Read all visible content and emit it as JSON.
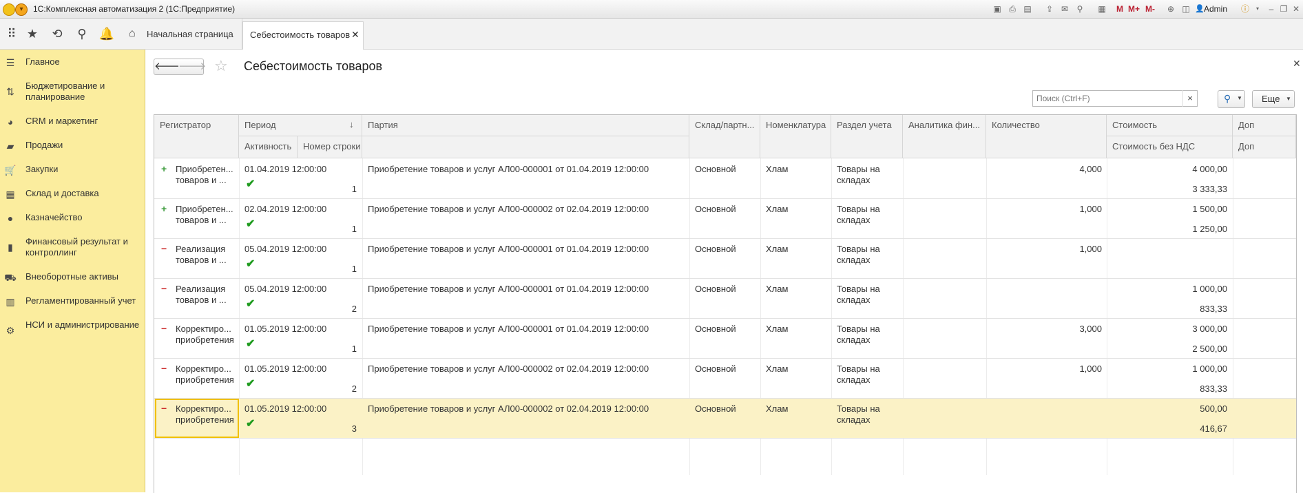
{
  "window": {
    "title": "1С:Комплексная автоматизация 2  (1С:Предприятие)",
    "user": "Admin"
  },
  "tabs": {
    "home": "Начальная страница",
    "active": "Себестоимость товаров"
  },
  "sidebar": {
    "items": [
      {
        "label": "Главное",
        "icon": "menu-icon"
      },
      {
        "label": "Бюджетирование и планирование",
        "icon": "budget-icon"
      },
      {
        "label": "CRM и маркетинг",
        "icon": "pie-chart-icon"
      },
      {
        "label": "Продажи",
        "icon": "bag-icon"
      },
      {
        "label": "Закупки",
        "icon": "cart-icon"
      },
      {
        "label": "Склад и доставка",
        "icon": "grid-icon"
      },
      {
        "label": "Казначейство",
        "icon": "coin-icon"
      },
      {
        "label": "Финансовый результат и контроллинг",
        "icon": "bar-chart-icon"
      },
      {
        "label": "Внеоборотные активы",
        "icon": "truck-icon"
      },
      {
        "label": "Регламентированный учет",
        "icon": "calculator-icon"
      },
      {
        "label": "НСИ и администрирование",
        "icon": "gear-icon"
      }
    ]
  },
  "form": {
    "title": "Себестоимость товаров"
  },
  "toolbar": {
    "search_placeholder": "Поиск (Ctrl+F)",
    "more_label": "Еще"
  },
  "table": {
    "headers": {
      "registrator": "Регистратор",
      "period": "Период",
      "sort_indicator": "↓",
      "activity": "Активность",
      "line_number": "Номер строки",
      "batch": "Партия",
      "warehouse": "Склад/партн...",
      "nomenclature": "Номенклатура",
      "accounting_section": "Раздел учета",
      "fin_analytics": "Аналитика фин...",
      "quantity": "Количество",
      "cost": "Стоимость",
      "cost_no_vat": "Стоимость без НДС",
      "extra_top": "Доп",
      "extra_bottom": "Доп"
    },
    "rows": [
      {
        "sign": "+",
        "registrator": "Приобретен... товаров и ...",
        "period": "01.04.2019 12:00:00",
        "active": true,
        "line_number": "1",
        "batch": "Приобретение товаров и услуг АЛ00-000001 от 01.04.2019 12:00:00",
        "warehouse": "Основной",
        "nomenclature": "Хлам",
        "section": "Товары на складах",
        "analytics": "",
        "quantity": "4,000",
        "cost": "4 000,00",
        "cost_no_vat": "3 333,33"
      },
      {
        "sign": "+",
        "registrator": "Приобретен... товаров и ...",
        "period": "02.04.2019 12:00:00",
        "active": true,
        "line_number": "1",
        "batch": "Приобретение товаров и услуг АЛ00-000002 от 02.04.2019 12:00:00",
        "warehouse": "Основной",
        "nomenclature": "Хлам",
        "section": "Товары на складах",
        "analytics": "",
        "quantity": "1,000",
        "cost": "1 500,00",
        "cost_no_vat": "1 250,00"
      },
      {
        "sign": "−",
        "registrator": "Реализация товаров и ...",
        "period": "05.04.2019 12:00:00",
        "active": true,
        "line_number": "1",
        "batch": "Приобретение товаров и услуг АЛ00-000001 от 01.04.2019 12:00:00",
        "warehouse": "Основной",
        "nomenclature": "Хлам",
        "section": "Товары на складах",
        "analytics": "",
        "quantity": "1,000",
        "cost": "",
        "cost_no_vat": ""
      },
      {
        "sign": "−",
        "registrator": "Реализация товаров и ...",
        "period": "05.04.2019 12:00:00",
        "active": true,
        "line_number": "2",
        "batch": "Приобретение товаров и услуг АЛ00-000001 от 01.04.2019 12:00:00",
        "warehouse": "Основной",
        "nomenclature": "Хлам",
        "section": "Товары на складах",
        "analytics": "",
        "quantity": "",
        "cost": "1 000,00",
        "cost_no_vat": "833,33"
      },
      {
        "sign": "−",
        "registrator": "Корректиро... приобретения",
        "period": "01.05.2019 12:00:00",
        "active": true,
        "line_number": "1",
        "batch": "Приобретение товаров и услуг АЛ00-000001 от 01.04.2019 12:00:00",
        "warehouse": "Основной",
        "nomenclature": "Хлам",
        "section": "Товары на складах",
        "analytics": "",
        "quantity": "3,000",
        "cost": "3 000,00",
        "cost_no_vat": "2 500,00"
      },
      {
        "sign": "−",
        "registrator": "Корректиро... приобретения",
        "period": "01.05.2019 12:00:00",
        "active": true,
        "line_number": "2",
        "batch": "Приобретение товаров и услуг АЛ00-000002 от 02.04.2019 12:00:00",
        "warehouse": "Основной",
        "nomenclature": "Хлам",
        "section": "Товары на складах",
        "analytics": "",
        "quantity": "1,000",
        "cost": "1 000,00",
        "cost_no_vat": "833,33"
      },
      {
        "sign": "−",
        "registrator": "Корректиро... приобретения",
        "period": "01.05.2019 12:00:00",
        "active": true,
        "line_number": "3",
        "batch": "Приобретение товаров и услуг АЛ00-000002 от 02.04.2019 12:00:00",
        "warehouse": "Основной",
        "nomenclature": "Хлам",
        "section": "Товары на складах",
        "analytics": "",
        "quantity": "",
        "cost": "500,00",
        "cost_no_vat": "416,67",
        "selected": true
      }
    ]
  },
  "colors": {
    "sidebar_bg": "#fbed9e",
    "selected_row": "#fbf2c6",
    "plus": "#3a9a3a",
    "minus": "#cc2b2b",
    "check": "#1e9b1e"
  }
}
